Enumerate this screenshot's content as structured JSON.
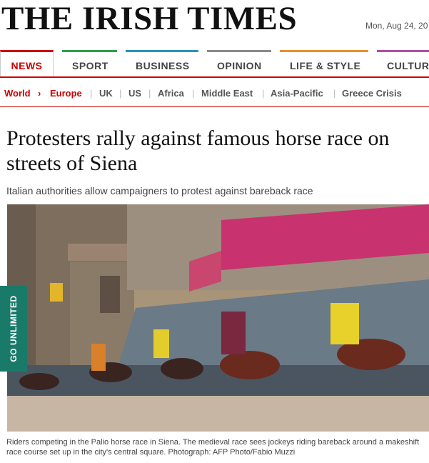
{
  "masthead": {
    "logo": "THE IRISH TIMES",
    "date": "Mon, Aug 24, 20"
  },
  "nav": {
    "items": [
      {
        "label": "NEWS",
        "color": "#cc0000",
        "active": true
      },
      {
        "label": "SPORT",
        "color": "#2e9e4a"
      },
      {
        "label": "BUSINESS",
        "color": "#2a93b6"
      },
      {
        "label": "OPINION",
        "color": "#888888"
      },
      {
        "label": "LIFE & STYLE",
        "color": "#e8912c"
      },
      {
        "label": "CULTUR",
        "color": "#b04fa0"
      }
    ]
  },
  "subnav": {
    "world": "World",
    "arrow": "›",
    "europe": "Europe",
    "items": [
      "UK",
      "US",
      "Africa",
      "Middle East",
      "Asia-Pacific",
      "Greece Crisis"
    ]
  },
  "article": {
    "headline": "Protesters rally against famous horse race on streets of Siena",
    "standfirst": "Italian authorities allow campaigners to protest against bareback race",
    "caption": "Riders competing in the Palio horse race in Siena. The medieval race sees jockeys riding bareback around a makeshift race course set up in the city's central square. Photograph: AFP Photo/Fabio Muzzi"
  },
  "promo": {
    "label": "GO UNLIMITED"
  },
  "colors": {
    "accent": "#cc0000",
    "promo": "#1a7a6a"
  }
}
